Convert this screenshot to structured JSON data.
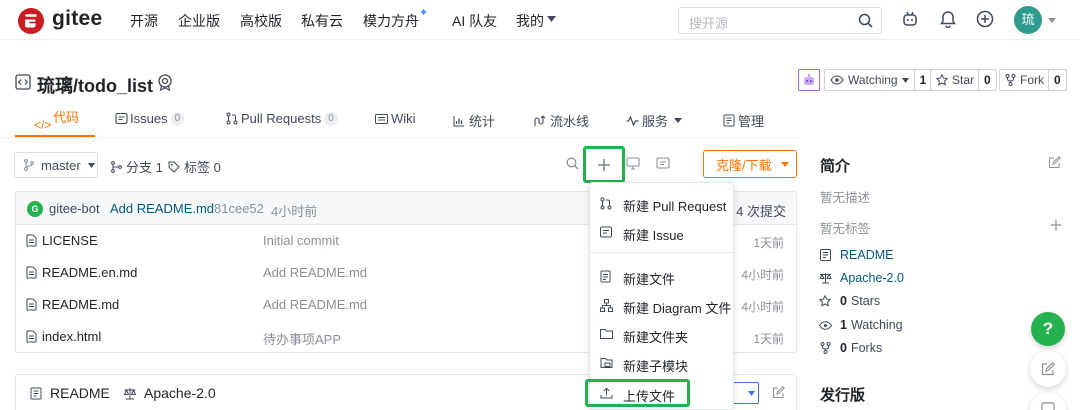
{
  "brand": {
    "name": "gitee",
    "color": "#c71d23"
  },
  "nav": {
    "items": [
      "开源",
      "企业版",
      "高校版",
      "私有云",
      "模力方舟",
      "AI 队友",
      "我的"
    ],
    "search_placeholder": "搜开源",
    "avatar_text": "琉"
  },
  "repo": {
    "title": "琉璃/todo_list",
    "watching_label": "Watching",
    "watching_count": "1",
    "star_label": "Star",
    "star_count": "0",
    "fork_label": "Fork",
    "fork_count": "0"
  },
  "tabs": [
    {
      "label": "代码",
      "icon": "code-icon"
    },
    {
      "label": "Issues",
      "badge": "0",
      "icon": "issue-icon"
    },
    {
      "label": "Pull Requests",
      "badge": "0",
      "icon": "pull-request-icon"
    },
    {
      "label": "Wiki",
      "icon": "wiki-icon"
    },
    {
      "label": "统计",
      "icon": "stats-icon"
    },
    {
      "label": "流水线",
      "icon": "pipeline-icon"
    },
    {
      "label": "服务",
      "icon": "service-icon"
    },
    {
      "label": "管理",
      "icon": "manage-icon"
    }
  ],
  "toolbar": {
    "branch": "master",
    "branches": "分支 1",
    "tags": "标签 0",
    "clone": "克隆/下载"
  },
  "commit": {
    "author": "gitee-bot",
    "message": "Add README.md",
    "hash": "81cee52",
    "time": "4小时前",
    "count": "4 次提交"
  },
  "files": [
    {
      "name": "LICENSE",
      "message": "Initial commit",
      "time": "1天前"
    },
    {
      "name": "README.en.md",
      "message": "Add README.md",
      "time": "4小时前"
    },
    {
      "name": "README.md",
      "message": "Add README.md",
      "time": "4小时前"
    },
    {
      "name": "index.html",
      "message": "待办事项APP",
      "time": "1天前"
    }
  ],
  "readme_bar": {
    "readme": "README",
    "license": "Apache-2.0"
  },
  "dropdown": [
    {
      "label": "新建 Pull Request",
      "icon": "pull-request-icon"
    },
    {
      "label": "新建 Issue",
      "icon": "issue-icon"
    },
    {
      "label": "新建文件",
      "icon": "file-icon"
    },
    {
      "label": "新建 Diagram 文件",
      "icon": "diagram-icon"
    },
    {
      "label": "新建文件夹",
      "icon": "folder-icon"
    },
    {
      "label": "新建子模块",
      "icon": "submodule-icon"
    },
    {
      "label": "上传文件",
      "icon": "upload-icon"
    }
  ],
  "sidebar": {
    "intro_title": "简介",
    "no_desc": "暂无描述",
    "no_tags": "暂无标签",
    "readme": "README",
    "license": "Apache-2.0",
    "stars_count": "0",
    "stars_label": "Stars",
    "watching_count": "1",
    "watching_label": "Watching",
    "forks_count": "0",
    "forks_label": "Forks",
    "release_title": "发行版"
  },
  "help_label": "?",
  "colors": {
    "accent": "#fe7300",
    "highlight": "#24b24e",
    "link": "#005980"
  }
}
